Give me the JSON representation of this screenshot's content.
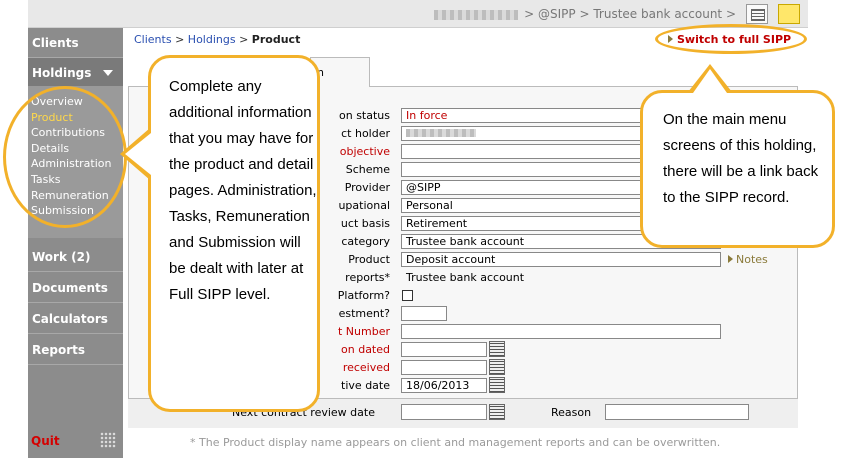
{
  "topbar": {
    "breadcrumb": "> @SIPP > Trustee bank account >"
  },
  "sidebar": {
    "clients": "Clients",
    "holdings": "Holdings",
    "submenu": [
      "Overview",
      "Product",
      "Contributions",
      "Details",
      "Administration",
      "Tasks",
      "Remuneration",
      "Submission"
    ],
    "work": "Work (2)",
    "documents": "Documents",
    "calculators": "Calculators",
    "reports": "Reports",
    "quit": "Quit"
  },
  "breadcrumb": {
    "clients": "Clients",
    "holdings": "Holdings",
    "sep": " > ",
    "current": "Product"
  },
  "switch_link": "Switch to full SIPP",
  "tab_label": "n",
  "form": {
    "rows": [
      {
        "label": "on status",
        "value": "In force",
        "label_red": false,
        "value_red": true
      },
      {
        "label": "ct holder",
        "value": "",
        "label_red": false
      },
      {
        "label": "objective",
        "value": "",
        "label_red": true
      },
      {
        "label": "Scheme",
        "value": "",
        "label_red": false
      },
      {
        "label": "Provider",
        "value": "@SIPP",
        "label_red": false
      },
      {
        "label": "upational",
        "value": "Personal",
        "label_red": false
      },
      {
        "label": "uct basis",
        "value": "Retirement",
        "label_red": false
      },
      {
        "label": "category",
        "value": "Trustee bank account",
        "label_red": false
      },
      {
        "label": "Product",
        "value": "Deposit account",
        "label_red": false
      },
      {
        "label": "reports*",
        "value": "Trustee bank account",
        "label_red": false
      },
      {
        "label": "Platform?",
        "value": "",
        "label_red": false
      },
      {
        "label": "estment?",
        "value": "",
        "label_red": false
      },
      {
        "label": "t Number",
        "value": "",
        "label_red": true
      },
      {
        "label": "on dated",
        "value": "",
        "label_red": true
      },
      {
        "label": "received",
        "value": "",
        "label_red": true
      },
      {
        "label": "tive date",
        "value": "18/06/2013",
        "label_red": false
      }
    ],
    "notes": "Notes",
    "review_label": "Next contract review date",
    "reason_label": "Reason"
  },
  "footnote": "* The Product display name appears on client and management reports and can be overwritten.",
  "callouts": {
    "left": "Complete any additional information that you may have for the product and detail pages. Administration, Tasks, Remuneration and Submission will be dealt with later at Full SIPP level.",
    "right": "On the main menu screens of this holding, there will be a link back to the SIPP record."
  },
  "colors": {
    "accent_orange": "#f2b12a",
    "link_blue": "#2a4fb0",
    "alert_red": "#c00000",
    "sidebar_grey": "#8c8c8c",
    "active_yellow": "#ffd84a"
  },
  "icons": {
    "grid": "grid-icon",
    "note": "sticky-note-icon",
    "calendar": "calendar-icon",
    "quit": "dots-icon"
  }
}
